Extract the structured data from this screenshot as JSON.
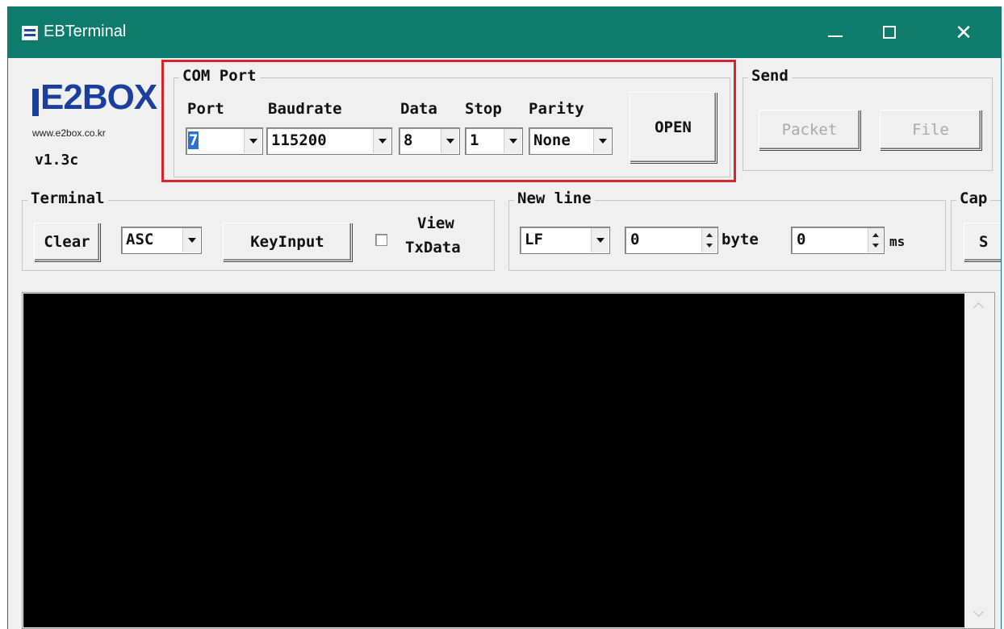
{
  "window": {
    "title": "EBTerminal",
    "minimize_glyph": "minimize-icon",
    "maximize_glyph": "maximize-icon",
    "close_glyph": "✕"
  },
  "brand": {
    "logo_text": "E2BOX",
    "url": "www.e2box.co.kr",
    "version": "v1.3c"
  },
  "com_port": {
    "group_title": "COM Port",
    "labels": {
      "port": "Port",
      "baudrate": "Baudrate",
      "data": "Data",
      "stop": "Stop",
      "parity": "Parity"
    },
    "port": "7",
    "baudrate": "115200",
    "data": "8",
    "stop": "1",
    "parity": "None",
    "open_label": "OPEN",
    "highlight_color": "#d6262b"
  },
  "send": {
    "group_title": "Send",
    "packet_label": "Packet",
    "file_label": "File"
  },
  "terminal": {
    "group_title": "Terminal",
    "clear_label": "Clear",
    "mode": "ASC",
    "keyinput_label": "KeyInput",
    "view_txdata_line1": "View",
    "view_txdata_line2": "TxData",
    "view_txdata_checked": false
  },
  "new_line": {
    "group_title": "New line",
    "mode": "LF",
    "byte_value": "0",
    "byte_unit": "byte",
    "ms_value": "0",
    "ms_unit": "ms"
  },
  "capture": {
    "group_title": "Cap",
    "button_label": "S"
  },
  "colors": {
    "titlebar": "#0f7b6c",
    "terminal_bg": "#000000",
    "logo": "#1a3f9e"
  }
}
